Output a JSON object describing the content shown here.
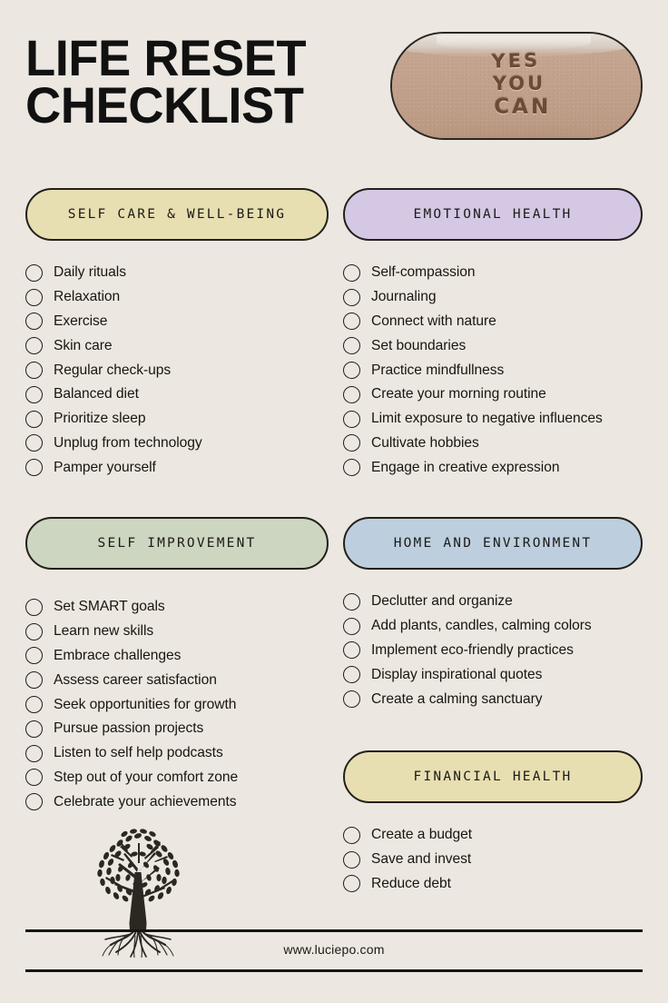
{
  "header": {
    "title_line1": "LIFE RESET",
    "title_line2": "CHECKLIST",
    "hero_image": {
      "alt": "beach-sand-photo",
      "word1": "YES",
      "word2": "YOU",
      "word3": "CAN"
    }
  },
  "colors": {
    "background": "#ece8e1",
    "ink": "#17150f",
    "self_care": "#e7dfb1",
    "emotional_health": "#d5c8e4",
    "self_improvement": "#ccd6c0",
    "home_environment": "#bdcfde",
    "financial_health": "#e7dfb1"
  },
  "sections": [
    {
      "id": "self-care-well-being",
      "title": "SELF CARE & WELL-BEING",
      "color": "#e7dfb1",
      "items": [
        "Daily rituals",
        "Relaxation",
        "Exercise",
        "Skin care",
        "Regular check-ups",
        "Balanced diet",
        "Prioritize sleep",
        "Unplug from technology",
        "Pamper yourself"
      ]
    },
    {
      "id": "emotional-health",
      "title": "EMOTIONAL HEALTH",
      "color": "#d5c8e4",
      "items": [
        "Self-compassion",
        "Journaling",
        "Connect with nature",
        "Set boundaries",
        "Practice mindfullness",
        "Create your morning routine",
        "Limit exposure to negative influences",
        "Cultivate hobbies",
        "Engage in creative expression"
      ]
    },
    {
      "id": "self-improvement",
      "title": "SELF IMPROVEMENT",
      "color": "#ccd6c0",
      "items": [
        "Set SMART goals",
        "Learn new skills",
        "Embrace challenges",
        "Assess career satisfaction",
        "Seek opportunities for growth",
        "Pursue passion projects",
        "Listen to self help podcasts",
        "Step out of your comfort zone",
        "Celebrate your achievements"
      ]
    },
    {
      "id": "home-and-environment",
      "title": "HOME AND ENVIRONMENT",
      "color": "#bdcfde",
      "items": [
        "Declutter and organize",
        "Add plants, candles, calming colors",
        "Implement eco-friendly practices",
        "Display inspirational quotes",
        "Create a calming sanctuary"
      ]
    },
    {
      "id": "financial-health",
      "title": "FINANCIAL HEALTH",
      "color": "#e7dfb1",
      "items": [
        "Create a budget",
        "Save and invest",
        "Reduce debt"
      ]
    }
  ],
  "decor": {
    "tree_alt": "tree-with-roots-illustration"
  },
  "footer": {
    "url": "www.luciepo.com"
  }
}
